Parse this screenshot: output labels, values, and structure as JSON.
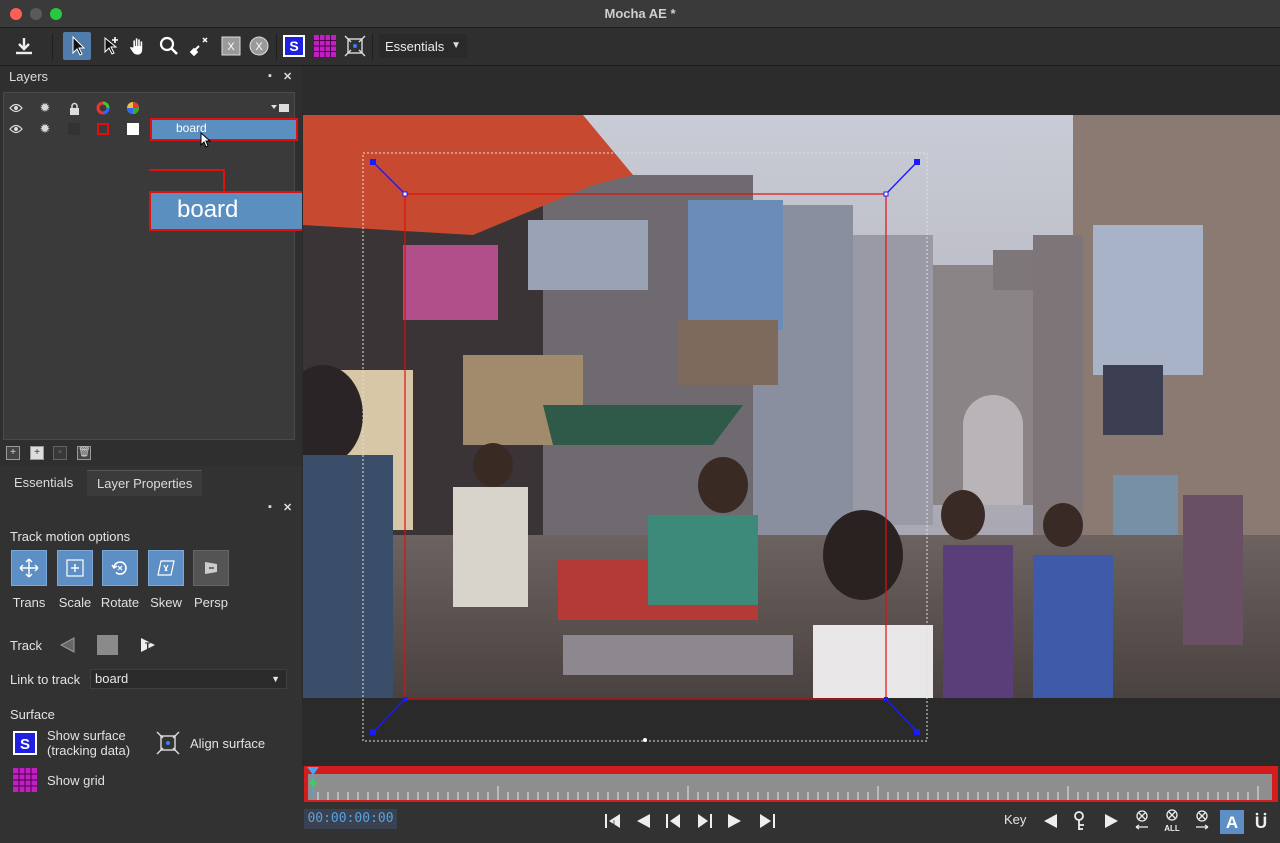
{
  "window": {
    "title": "Mocha AE *"
  },
  "toolbar": {
    "workspace_label": "Essentials"
  },
  "layers_panel": {
    "title": "Layers",
    "layer_name": "board",
    "layer_name_zoom": "board"
  },
  "props_panel": {
    "tab_essentials": "Essentials",
    "tab_layer_properties": "Layer Properties",
    "track_motion_title": "Track motion options",
    "motion": {
      "trans": "Trans",
      "scale": "Scale",
      "rotate": "Rotate",
      "skew": "Skew",
      "persp": "Persp"
    },
    "track_label": "Track",
    "link_to_track_label": "Link to track",
    "link_to_track_value": "board",
    "surface_title": "Surface",
    "show_surface_line1": "Show surface",
    "show_surface_line2": "(tracking data)",
    "align_surface": "Align surface",
    "show_grid": "Show grid"
  },
  "timeline": {
    "timecode": "00:00:00:00",
    "key_label": "Key",
    "all_label": "ALL"
  },
  "colors": {
    "accent_blue": "#5e8fc4",
    "selection_red": "#e01010",
    "surface_blue": "#1a1aff",
    "timecode_text": "#56a3e0"
  }
}
